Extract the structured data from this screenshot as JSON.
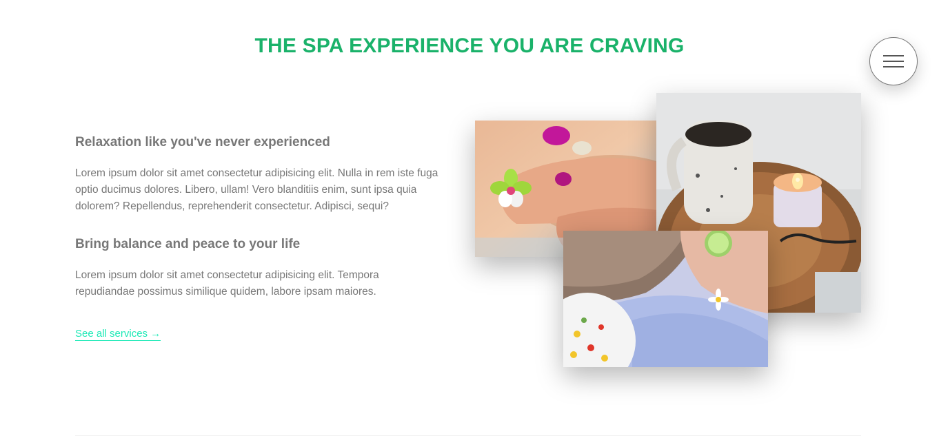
{
  "section": {
    "title": "THE SPA EXPERIENCE YOU ARE CRAVING"
  },
  "menu": {
    "icon": "hamburger-menu-icon"
  },
  "features": [
    {
      "title": "Relaxation like you've never experienced",
      "text": "Lorem ipsum dolor sit amet consectetur adipisicing elit. Nulla in rem iste fuga optio ducimus dolores. Libero, ullam! Vero blanditiis enim, sunt ipsa quia dolorem? Repellendus, reprehenderit consectetur. Adipisci, sequi?"
    },
    {
      "title": "Bring balance and peace to your life",
      "text": "Lorem ipsum dolor sit amet consectetur adipisicing elit. Tempora repudiandae possimus similique quidem, labore ipsam maiores."
    }
  ],
  "link": {
    "label": "See all services →"
  },
  "colors": {
    "accent_title": "#1ab26a",
    "accent_link": "#1de9b6",
    "body_text": "#777777"
  }
}
